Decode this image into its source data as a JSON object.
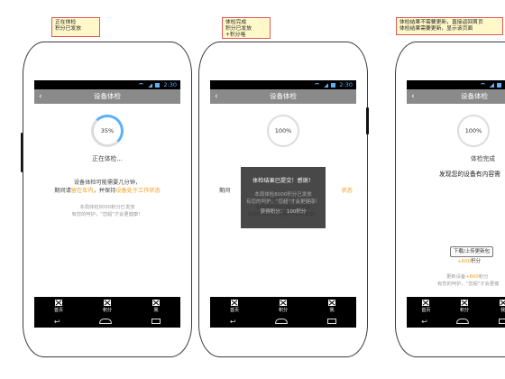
{
  "notes": [
    {
      "lines": [
        "正在体检",
        "积分已发放"
      ]
    },
    {
      "lines": [
        "体检完成",
        "积分已发放",
        "+积分咯"
      ]
    },
    {
      "lines": [
        "体检结果不需要更新，直接返回首页",
        "体检结果需要更新，显示该页面"
      ]
    }
  ],
  "status": {
    "time": "2:30"
  },
  "titlebar": {
    "title": "设备体检",
    "back": "‹"
  },
  "screens": [
    {
      "progress": "35%",
      "progress_fraction": 0.35,
      "status_text": "正在体检...",
      "line1": "设备体检可能需要几分钟，",
      "line2_a": "期间请",
      "line2_b": "留在车内",
      "line2_c": "，并保持",
      "line2_d": "设备处于工作状态",
      "note1": "本周体检8000积分已发放",
      "note2": "有您的呵护，\"您超\"才会更健康！"
    },
    {
      "progress": "100%",
      "progress_fraction": 1.0,
      "bg_line2_a": "期间",
      "bg_line2_d": "状态",
      "overlay_title": "体检结果已提交！感谢！",
      "overlay_l1": "本周体检8000积分已发放",
      "overlay_l2": "有您的呵护，\"您超\"才会更健康！",
      "overlay_l3": "获得积分：   100积分",
      "note1": "本周体检8000积分已发放",
      "note2": "有您的呵护，\"您超\"才会更健康！"
    },
    {
      "progress": "100%",
      "progress_fraction": 1.0,
      "done_text": "体检完成",
      "found_text": "发现您的设备有内容需",
      "update_button": "下载/上传更新包",
      "points_prefix": "+",
      "points": "600",
      "points_suffix": "积分",
      "note1_a": "更新设备",
      "note1_b": "+600",
      "note1_c": "积分",
      "note2": "有您的呵护，\"您超\"才会更健"
    }
  ],
  "tabs": [
    {
      "label": "首页"
    },
    {
      "label": "积分"
    },
    {
      "label": "我"
    }
  ],
  "colors": {
    "accent_blue": "#5cb0ff",
    "orange": "#f29c1f",
    "titlebar": "#8a8a8a"
  }
}
